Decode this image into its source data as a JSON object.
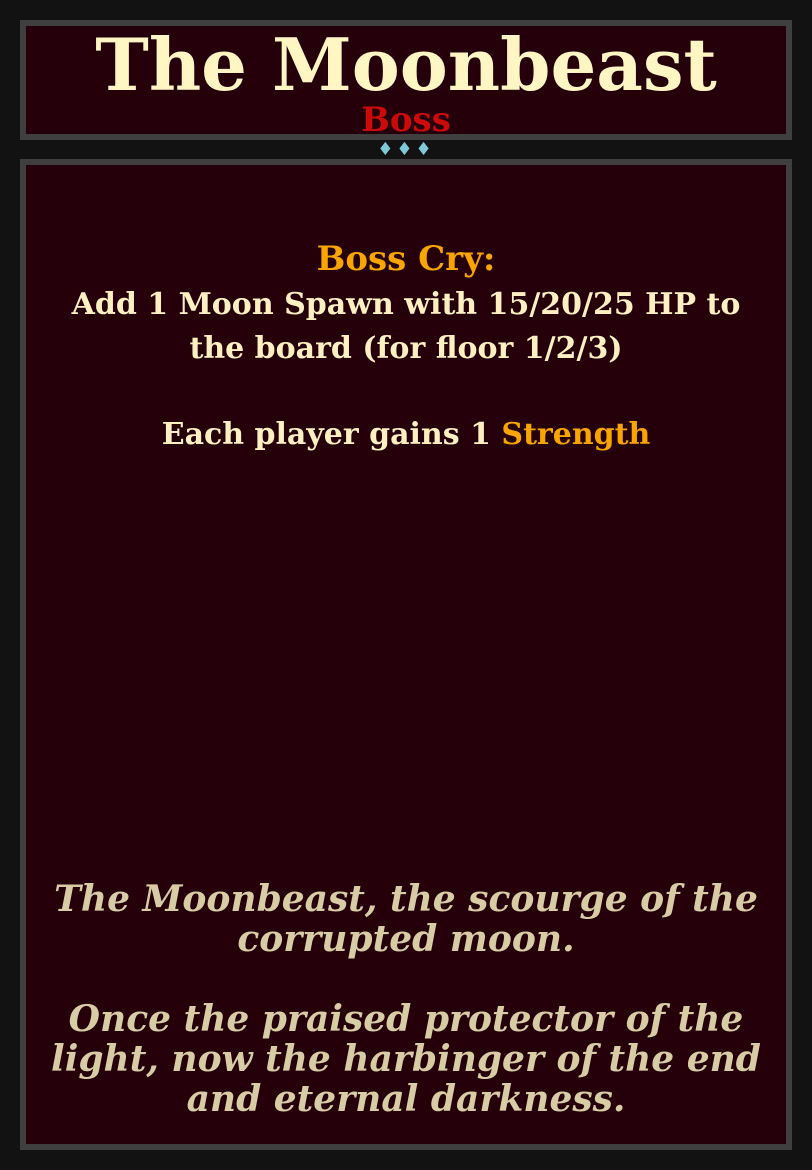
{
  "card": {
    "title": "The Moonbeast",
    "type_label": "Boss",
    "gem_glyphs": "♦♦♦",
    "effect": {
      "heading": "Boss Cry:",
      "line1": "Add 1 Moon Spawn with 15/20/25 HP to the board (for floor 1/2/3)",
      "line2_prefix": "Each player gains 1",
      "line2_keyword": "Strength"
    },
    "flavor": {
      "paragraph1": "The Moonbeast, the scourge of the corrupted moon.",
      "paragraph2": "Once the praised protector of the light, now the harbinger of the end and eternal darkness."
    }
  },
  "colors": {
    "background": "#121212",
    "panel": "#25000b",
    "border": "#3f3f3f",
    "title": "#fff6c4",
    "type_label": "#cc0a0a",
    "keyword": "#f8a500",
    "body_text": "#fff0c2",
    "flavor_text": "#d8cca4",
    "gems": "#7ec8d8"
  }
}
